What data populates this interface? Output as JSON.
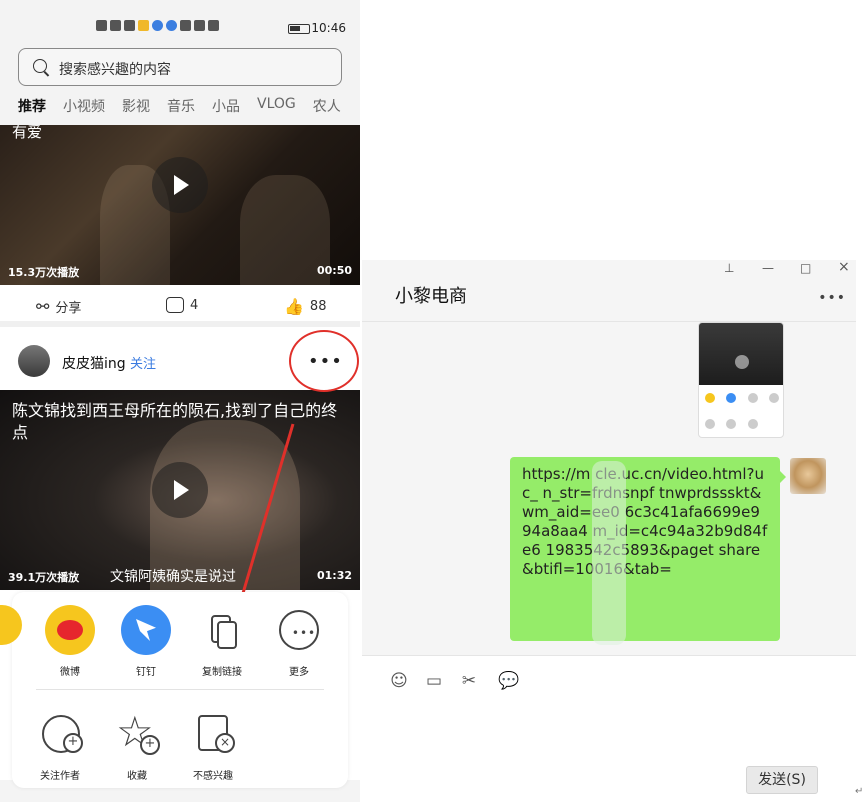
{
  "phone": {
    "status_time": "10:46",
    "search_placeholder": "搜索感兴趣的内容",
    "tabs": [
      "推荐",
      "小视频",
      "影视",
      "音乐",
      "小品",
      "VLOG",
      "农人"
    ],
    "video1": {
      "caption_fragment": "有爱",
      "plays": "15.3万次播放",
      "duration": "00:50"
    },
    "actions": {
      "share": "分享",
      "comments": "4",
      "likes": "88"
    },
    "author": {
      "name": "皮皮猫ing",
      "follow": "关注",
      "more": "•••"
    },
    "video2": {
      "title": "陈文锦找到西王母所在的陨石,找到了自己的终点",
      "plays": "39.1万次播放",
      "subtitle": "文锦阿姨确实是说过",
      "duration": "01:32"
    },
    "share_sheet": {
      "row1": [
        "微博",
        "钉钉",
        "复制链接",
        "更多"
      ],
      "row2": [
        "关注作者",
        "收藏",
        "不感兴趣"
      ]
    }
  },
  "chat": {
    "title": "小黎电商",
    "more": "•••",
    "message": "https://m        cle.uc.cn/video.html?uc_           n_str=frdnsnpf          tnwprdssskt&wm_aid=ee0       6c3c41afa6699e994a8aa4        m_id=c4c94a32b9d84fe6        1983542c5893&paget        share&btifl=10016&tab=",
    "send_label": "发送(S)",
    "window_controls": [
      "⊥",
      "—",
      "□",
      "×"
    ]
  },
  "colors": {
    "bubble": "#95ec69",
    "accent_red": "#e0302a",
    "link_blue": "#3a7be0"
  }
}
